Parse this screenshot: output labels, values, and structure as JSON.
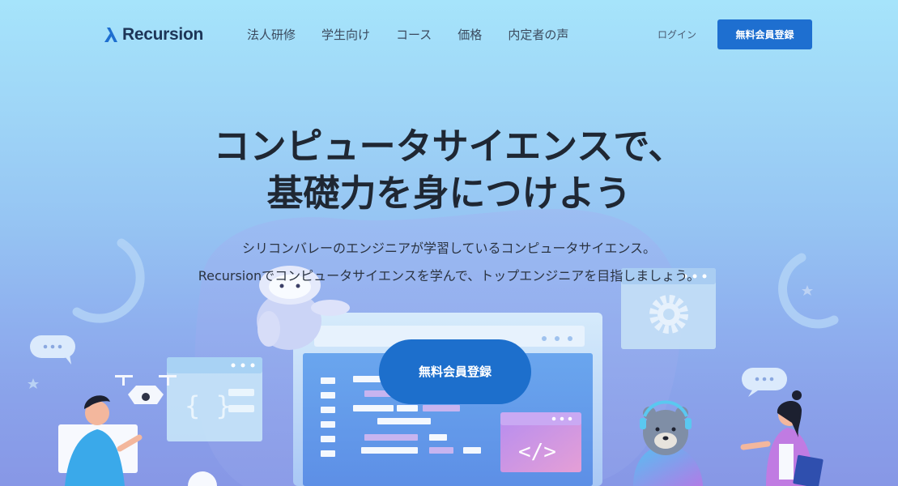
{
  "brand": {
    "name": "Recursion",
    "color": "#1e6fd0"
  },
  "nav": {
    "links": [
      "法人研修",
      "学生向け",
      "コース",
      "価格",
      "内定者の声"
    ],
    "login": "ログイン",
    "signup": "無料会員登録"
  },
  "hero": {
    "title_line1": "コンピュータサイエンスで、",
    "title_line2": "基礎力を身につけよう",
    "sub_line1": "シリコンバレーのエンジニアが学習しているコンピュータサイエンス。",
    "sub_line2": "Recursionでコンピュータサイエンスを学んで、トップエンジニアを目指しましょう。",
    "cta": "無料会員登録"
  },
  "illustration": {
    "code_braces": "{ }",
    "code_tag": "</>",
    "icons": [
      "drone-icon",
      "robot-icon",
      "gear-icon",
      "chat-bubble-icon",
      "star-icon",
      "person-icon",
      "bear-icon",
      "woman-icon"
    ]
  }
}
